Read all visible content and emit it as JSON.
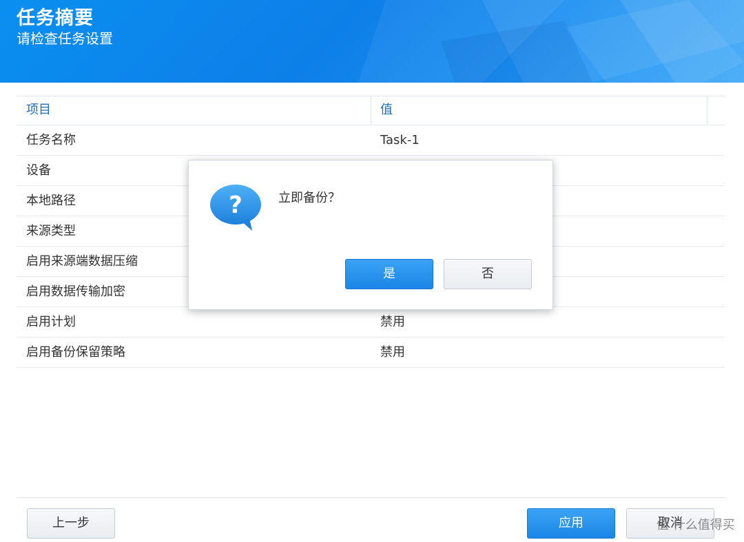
{
  "header": {
    "title": "任务摘要",
    "subtitle": "请检查任务设置"
  },
  "table": {
    "columns": [
      "项目",
      "值"
    ],
    "rows": [
      {
        "item": "任务名称",
        "value": "Task-1"
      },
      {
        "item": "设备",
        "value": ""
      },
      {
        "item": "本地路径",
        "value": ""
      },
      {
        "item": "来源类型",
        "value": ""
      },
      {
        "item": "启用来源端数据压缩",
        "value": ""
      },
      {
        "item": "启用数据传输加密",
        "value": ""
      },
      {
        "item": "启用计划",
        "value": "禁用"
      },
      {
        "item": "启用备份保留策略",
        "value": "禁用"
      }
    ]
  },
  "footer": {
    "prev_label": "上一步",
    "apply_label": "应用",
    "cancel_label": "取消",
    "watermark": "值 什么值得买"
  },
  "dialog": {
    "icon": "question-bubble-icon",
    "message": "立即备份？",
    "yes_label": "是",
    "no_label": "否"
  },
  "colors": {
    "banner": "#0d7fe8",
    "primary_button": "#1b86e6",
    "header_text": "#1a6fb8"
  }
}
